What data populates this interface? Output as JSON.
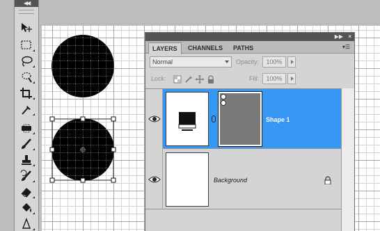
{
  "tools_panel": {
    "collapse_icon": "double-chevron-left-icon",
    "tools": [
      {
        "name": "move-tool-icon"
      },
      {
        "name": "marquee-tool-icon"
      },
      {
        "name": "lasso-tool-icon"
      },
      {
        "name": "quick-selection-tool-icon"
      },
      {
        "name": "crop-tool-icon"
      },
      {
        "name": "eyedropper-tool-icon"
      },
      {
        "name": "healing-brush-tool-icon"
      },
      {
        "name": "brush-tool-icon"
      },
      {
        "name": "clone-stamp-tool-icon"
      },
      {
        "name": "history-brush-tool-icon"
      },
      {
        "name": "eraser-tool-icon"
      },
      {
        "name": "paint-bucket-tool-icon"
      },
      {
        "name": "blur-tool-icon"
      }
    ]
  },
  "layers_panel": {
    "tabs": [
      {
        "label": "LAYERS",
        "active": true
      },
      {
        "label": "CHANNELS",
        "active": false
      },
      {
        "label": "PATHS",
        "active": false
      }
    ],
    "blend_mode": "Normal",
    "opacity_label": "Opacity:",
    "opacity_value": "100%",
    "lock_label": "Lock:",
    "fill_label": "Fill:",
    "fill_value": "100%",
    "layers": [
      {
        "name": "Shape 1",
        "selected": true,
        "visible": true,
        "has_vector_mask": true
      },
      {
        "name": "Background",
        "selected": false,
        "visible": true,
        "locked": true
      }
    ],
    "colors": {
      "selection": "#3797f5",
      "panel_bg": "#d4d4d4"
    }
  },
  "canvas": {
    "shapes": [
      "circle",
      "circle-selected-with-transform-handles"
    ]
  }
}
